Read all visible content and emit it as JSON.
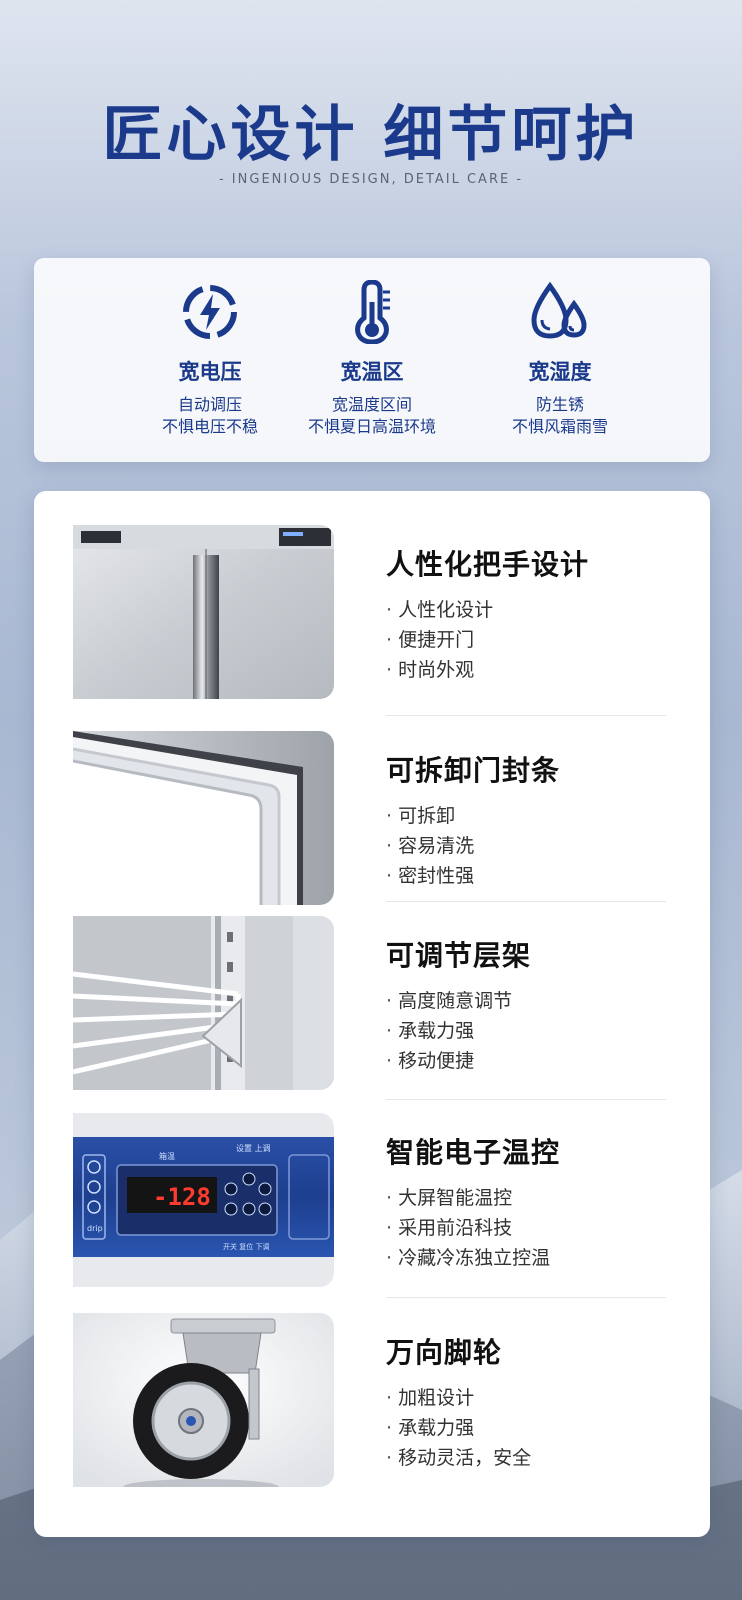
{
  "header": {
    "title": "匠心设计 细节呵护",
    "subtitle": "- INGENIOUS DESIGN, DETAIL CARE -"
  },
  "features": [
    {
      "icon": "voltage-icon",
      "title": "宽电压",
      "line1": "自动调压",
      "line2": "不惧电压不稳"
    },
    {
      "icon": "thermometer-icon",
      "title": "宽温区",
      "line1": "宽温度区间",
      "line2": "不惧夏日高温环境"
    },
    {
      "icon": "water-drops-icon",
      "title": "宽湿度",
      "line1": "防生锈",
      "line2": "不惧风霜雨雪"
    }
  ],
  "details": [
    {
      "title": "人性化把手设计",
      "points": [
        "人性化设计",
        "便捷开门",
        "时尚外观"
      ],
      "image": "handle-photo"
    },
    {
      "title": "可拆卸门封条",
      "points": [
        "可拆卸",
        "容易清洗",
        "密封性强"
      ],
      "image": "door-seal-photo"
    },
    {
      "title": "可调节层架",
      "points": [
        "高度随意调节",
        "承载力强",
        "移动便捷"
      ],
      "image": "shelf-photo"
    },
    {
      "title": "智能电子温控",
      "points": [
        "大屏智能温控",
        "采用前沿科技",
        "冷藏冷冻独立控温"
      ],
      "image": "control-panel-photo"
    },
    {
      "title": "万向脚轮",
      "points": [
        "加粗设计",
        "承载力强",
        "移动灵活，安全"
      ],
      "image": "caster-wheel-photo"
    }
  ],
  "panel": {
    "display": "-128",
    "label_top_left": "箱温",
    "label_top_right": "设置 上调",
    "label_bottom": "开关 复位 下调",
    "label_drip": "drip"
  },
  "colors": {
    "accent": "#1b3a8c",
    "display_red": "#ff3b2f",
    "panel_blue": "#1d3f8f"
  }
}
